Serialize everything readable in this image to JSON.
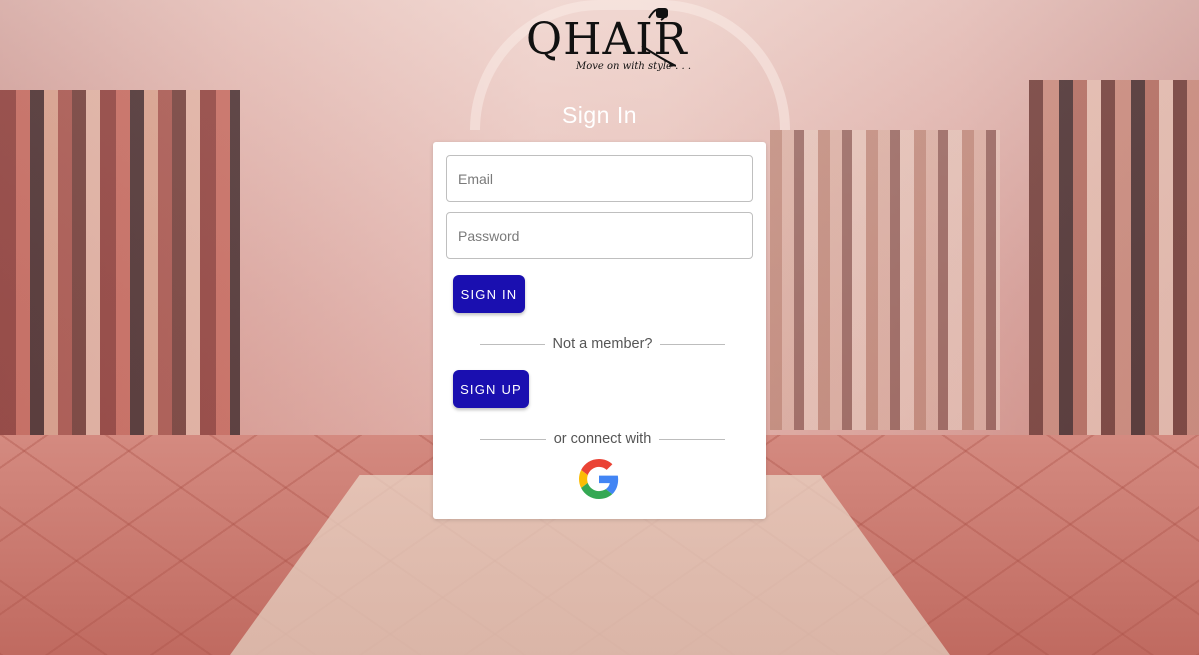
{
  "logo": {
    "text": "QHAIR",
    "tagline": "Move on with style . . ."
  },
  "page_title": "Sign In",
  "form": {
    "email_placeholder": "Email",
    "password_placeholder": "Password",
    "signin_label": "SIGN IN",
    "not_member_text": "Not a member?",
    "signup_label": "SIGN UP",
    "connect_text": "or connect with"
  },
  "social": {
    "google_icon": "google-icon"
  },
  "colors": {
    "button": "#1a0fb0",
    "title": "#ffffff"
  }
}
